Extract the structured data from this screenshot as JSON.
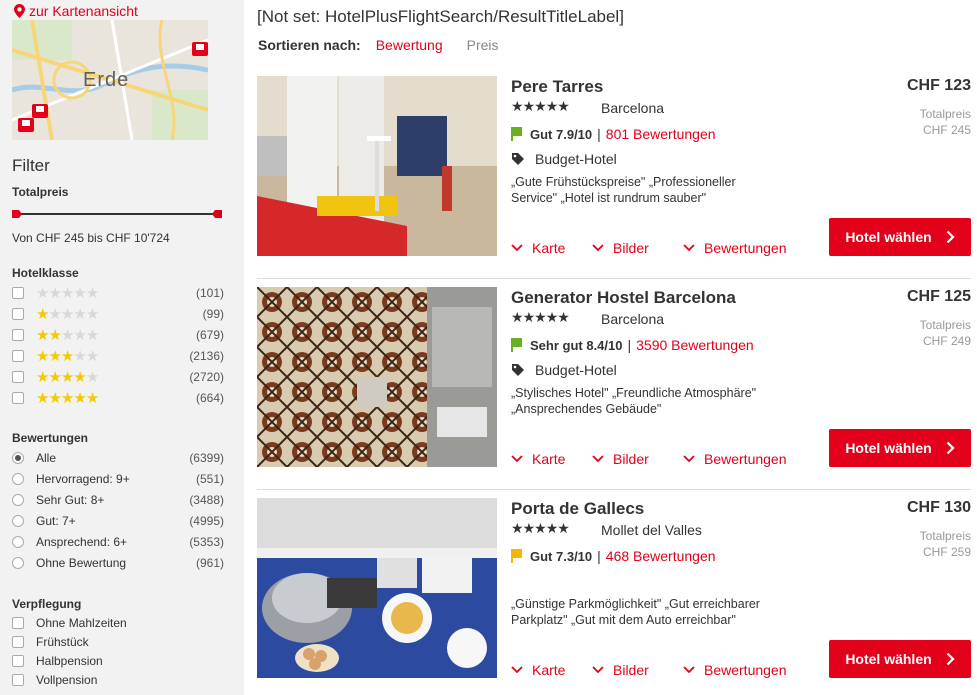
{
  "sidebar": {
    "map_link": "zur Kartenansicht",
    "map_label": "Erde",
    "filter_title": "Filter",
    "totalprice": {
      "title": "Totalpreis",
      "range_text": "Von CHF 245 bis CHF 10'724"
    },
    "hotelclass": {
      "title": "Hotelklasse",
      "items": [
        {
          "stars": 0,
          "count": "(101)"
        },
        {
          "stars": 1,
          "count": "(99)"
        },
        {
          "stars": 2,
          "count": "(679)"
        },
        {
          "stars": 3,
          "count": "(2136)"
        },
        {
          "stars": 4,
          "count": "(2720)"
        },
        {
          "stars": 5,
          "count": "(664)"
        }
      ]
    },
    "reviews": {
      "title": "Bewertungen",
      "items": [
        {
          "label": "Alle",
          "count": "(6399)",
          "selected": true
        },
        {
          "label": "Hervorragend: 9+",
          "count": "(551)",
          "selected": false
        },
        {
          "label": "Sehr Gut: 8+",
          "count": "(3488)",
          "selected": false
        },
        {
          "label": "Gut: 7+",
          "count": "(4995)",
          "selected": false
        },
        {
          "label": "Ansprechend: 6+",
          "count": "(5353)",
          "selected": false
        },
        {
          "label": "Ohne Bewertung",
          "count": "(961)",
          "selected": false
        }
      ]
    },
    "meals": {
      "title": "Verpflegung",
      "items": [
        {
          "label": "Ohne Mahlzeiten"
        },
        {
          "label": "Frühstück"
        },
        {
          "label": "Halbpension"
        },
        {
          "label": "Vollpension"
        }
      ]
    }
  },
  "main": {
    "result_title": "[Not set: HotelPlusFlightSearch/ResultTitleLabel]",
    "sort": {
      "label": "Sortieren nach:",
      "options": [
        "Bewertung",
        "Preis"
      ],
      "active": "Bewertung"
    },
    "hotels": [
      {
        "name": "Pere Tarres",
        "stars": 0,
        "city": "Barcelona",
        "rating_text": "Gut 7.9/10",
        "rating_color": "#6ab023",
        "reviews": "801 Bewertungen",
        "type": "Budget-Hotel",
        "quote": "„Gute Frühstückspreise\" „Professioneller Service\" „Hotel ist rundrum sauber\"",
        "price": "CHF 123",
        "total_label": "Totalpreis",
        "total_price": "CHF 245",
        "actions": [
          "Karte",
          "Bilder",
          "Bewertungen"
        ],
        "button": "Hotel wählen"
      },
      {
        "name": "Generator Hostel Barcelona",
        "stars": 0,
        "city": "Barcelona",
        "rating_text": "Sehr gut 8.4/10",
        "rating_color": "#6ab023",
        "reviews": "3590 Bewertungen",
        "type": "Budget-Hotel",
        "quote": "„Stylisches Hotel\" „Freundliche Atmosphäre\" „Ansprechendes Gebäude\"",
        "price": "CHF 125",
        "total_label": "Totalpreis",
        "total_price": "CHF 249",
        "actions": [
          "Karte",
          "Bilder",
          "Bewertungen"
        ],
        "button": "Hotel wählen"
      },
      {
        "name": "Porta de Gallecs",
        "stars": 3,
        "city": "Mollet del Valles",
        "rating_text": "Gut 7.3/10",
        "rating_color": "#f5b800",
        "reviews": "468 Bewertungen",
        "type": "",
        "quote": "„Günstige Parkmöglichkeit\" „Gut erreichbarer Parkplatz\" „Gut mit dem Auto erreichbar\"",
        "price": "CHF 130",
        "total_label": "Totalpreis",
        "total_price": "CHF 259",
        "actions": [
          "Karte",
          "Bilder",
          "Bewertungen"
        ],
        "button": "Hotel wählen"
      }
    ]
  },
  "colors": {
    "accent": "#e2001a",
    "star_on": "#f7c800",
    "star_off": "#d8d8d8"
  }
}
